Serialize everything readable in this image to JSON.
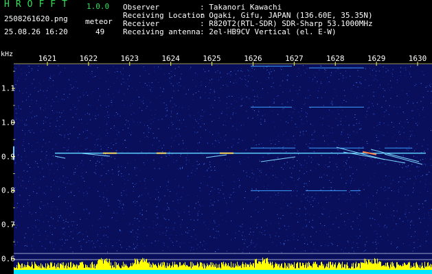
{
  "header": {
    "app_title": "HROFFT",
    "version": "1.0.0",
    "filename": "2508261620.png",
    "datetime": "25.08.26 16:20",
    "meteor_label": "meteor",
    "meteor_count": "49"
  },
  "station": {
    "observer_label": "Observer",
    "observer_value": ": Takanori Kawachi",
    "location_label": "Receiving Location",
    "location_value": ": Ogaki, Gifu, JAPAN (136.60E, 35.35N)",
    "receiver_label": "Receiver",
    "receiver_value": ": R820T2(RTL-SDR) SDR-Sharp 53.1000MHz",
    "antenna_label": "Receiving antenna",
    "antenna_value": ": 2el-HB9CV Vertical (el. E-W)"
  },
  "axis": {
    "y_unit": "kHz",
    "x_ticks": [
      "1621",
      "1622",
      "1623",
      "1624",
      "1625",
      "1626",
      "1627",
      "1628",
      "1629",
      "1630"
    ],
    "y_ticks": [
      "1.1",
      "1.0",
      "0.9",
      "0.8",
      "0.7",
      "0.6"
    ]
  },
  "colors": {
    "background": "#000000",
    "spectrogram_bg": "#0a0f5c",
    "title_green": "#2fe05a",
    "axis_tick": "#ffff66",
    "signal": "#5cd0ff",
    "level_bars": "#ffff00",
    "level_base": "#00e5ff"
  },
  "chart_data": {
    "type": "heatmap",
    "x_range": [
      1620.7,
      1630.2
    ],
    "y_range": [
      0.6,
      1.2
    ],
    "carrier_freq_khz": 0.91
  }
}
